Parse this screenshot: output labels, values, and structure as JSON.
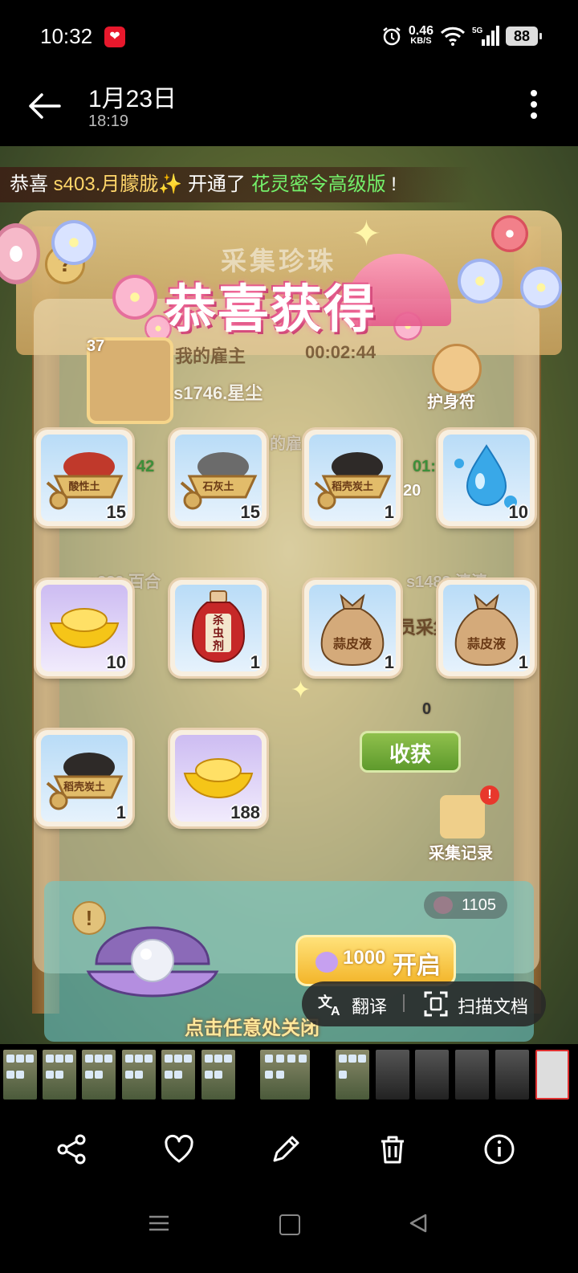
{
  "status_bar": {
    "time": "10:32",
    "net_speed_value": "0.46",
    "net_speed_unit": "KB/S",
    "signal_label": "5G",
    "battery": "88",
    "icons": [
      "alarm-icon",
      "wifi-icon",
      "signal-icon",
      "battery-icon"
    ]
  },
  "header": {
    "date": "1月23日",
    "time": "18:19"
  },
  "photo": {
    "banner": {
      "prefix": "恭喜",
      "player": "s403.月朦胧✨",
      "middle": "开通了",
      "product": "花灵密令高级版",
      "suffix": "!"
    },
    "bg_title": "采集珍珠",
    "congrats_title": "恭喜获得",
    "employer": {
      "level": "37",
      "label": "我的雇主",
      "timer": "00:02:44",
      "name": "s1746.星尘",
      "amulet_label": "护身符"
    },
    "bg_fragments": {
      "partial_1": "的雇",
      "num_a": "42",
      "num_b": "01:",
      "num_c": "20",
      "name_left": "s239.百合",
      "name_right": "s1482.清清",
      "collect_partial": "员采集",
      "zero": "0"
    },
    "items": [
      {
        "name": "酸性土",
        "count": "15",
        "color": "#c0392b",
        "kind": "cart"
      },
      {
        "name": "石灰土",
        "count": "15",
        "color": "#6b6b6b",
        "kind": "cart"
      },
      {
        "name": "稻壳炭土",
        "count": "1",
        "color": "#2e2a28",
        "kind": "cart"
      },
      {
        "name": "water",
        "count": "10",
        "color": "#39a8e8",
        "kind": "drop"
      },
      {
        "name": "gold",
        "count": "10",
        "color": "#f5c518",
        "kind": "ingot"
      },
      {
        "name": "杀虫剂",
        "count": "1",
        "color": "#c62828",
        "kind": "bottle"
      },
      {
        "name": "蒜皮液",
        "count": "1",
        "color": "#b98a5a",
        "kind": "sack"
      },
      {
        "name": "蒜皮液",
        "count": "1",
        "color": "#b98a5a",
        "kind": "sack"
      },
      {
        "name": "稻壳炭土",
        "count": "1",
        "color": "#2e2a28",
        "kind": "cart"
      },
      {
        "name": "gold",
        "count": "188",
        "color": "#f5c518",
        "kind": "ingot"
      }
    ],
    "bottle_text_top": "杀",
    "bottle_text_mid": "虫",
    "bottle_text_bot": "剂",
    "harvest_button": "收获",
    "record_label": "采集记录",
    "record_badge": "!",
    "pearl_balance": "1105",
    "open_button": {
      "cost": "1000",
      "label": "开启"
    },
    "info_label": "!",
    "close_hint": "点击任意处关闭"
  },
  "overlay": {
    "translate": "翻译",
    "scan": "扫描文档"
  },
  "thumbnails": {
    "count": 14
  },
  "actions": {
    "icons": [
      "share-icon",
      "favorite-icon",
      "edit-icon",
      "delete-icon",
      "info-icon"
    ]
  },
  "colors": {
    "accent_green": "#74f06a",
    "accent_gold": "#ffd66a",
    "title_pink": "#c2396b"
  }
}
